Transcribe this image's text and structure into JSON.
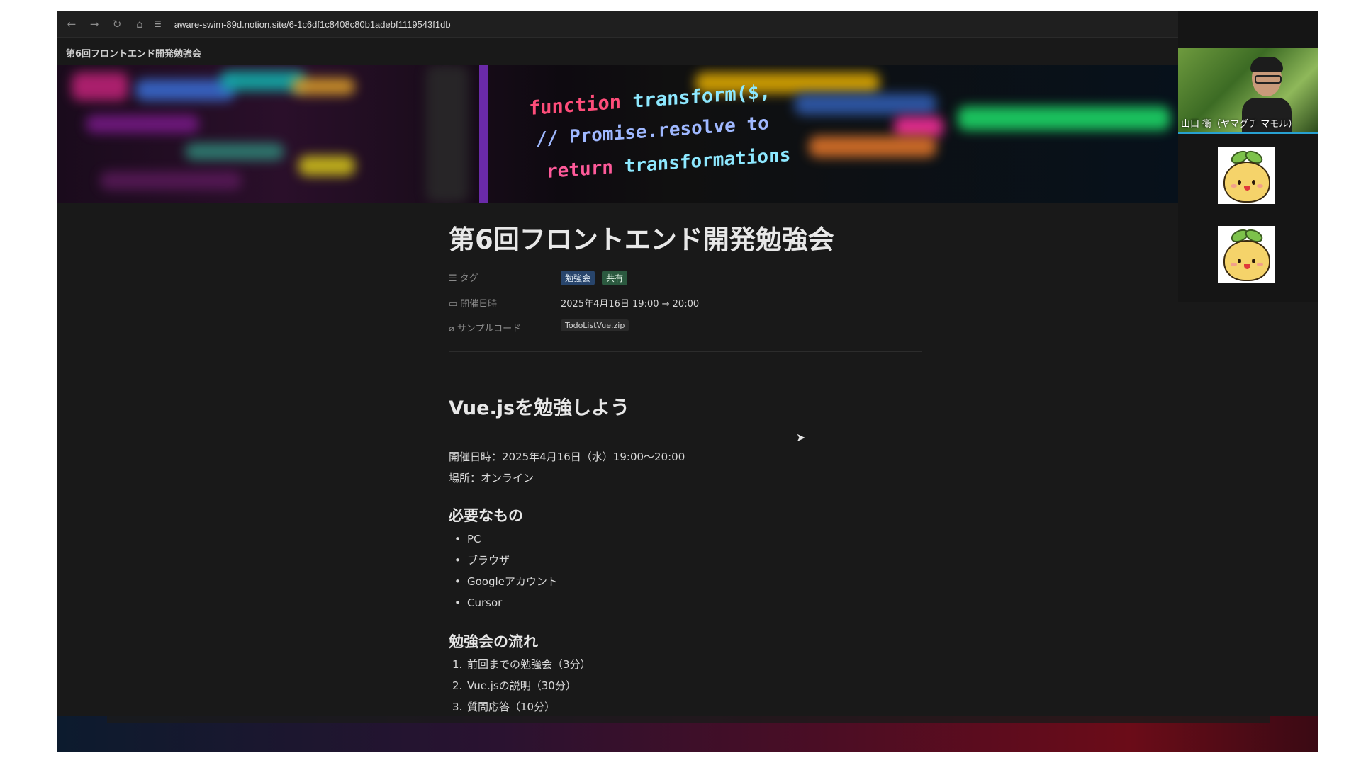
{
  "browser": {
    "url": "aware-swim-89d.notion.site/6-1c6df1c8408c80b1adebf1119543f1db",
    "nav_icons": [
      "back-arrow-icon",
      "forward-arrow-icon",
      "reload-icon",
      "home-icon",
      "site-settings-icon"
    ]
  },
  "notion": {
    "breadcrumb": "第6回フロントエンド開発勉強会",
    "cover_code": {
      "line1_keyword": "function",
      "line1_name": "transform($,",
      "line2": "// Promise.resolve to",
      "line3_keyword": "return",
      "line3_name": "transformations"
    },
    "title": "第6回フロントエンド開発勉強会",
    "properties": {
      "tag_label": "タグ",
      "tags": [
        "勉強会",
        "共有"
      ],
      "date_label": "開催日時",
      "date_value": "2025年4月16日 19:00 → 20:00",
      "code_label": "サンプルコード",
      "code_file": "TodoListVue.zip"
    },
    "heading": "Vue.jsを勉強しよう",
    "datetime_line": "開催日時：2025年4月16日（水）19:00〜20:00",
    "place_line": "場所：オンライン",
    "needs_heading": "必要なもの",
    "needs": [
      "PC",
      "ブラウザ",
      "Googleアカウント",
      "Cursor"
    ],
    "flow_heading": "勉強会の流れ",
    "flow": [
      "前回までの勉強会（3分）",
      "Vue.jsの説明（30分）",
      "質問応答（10分）"
    ]
  },
  "call": {
    "participant_name": "山口 衛（ヤマグチ マモル）"
  },
  "colors": {
    "page_bg": "#191919",
    "tag_blue": "#28456c",
    "tag_green": "#2b593f",
    "active_speaker": "#28a0d0"
  }
}
